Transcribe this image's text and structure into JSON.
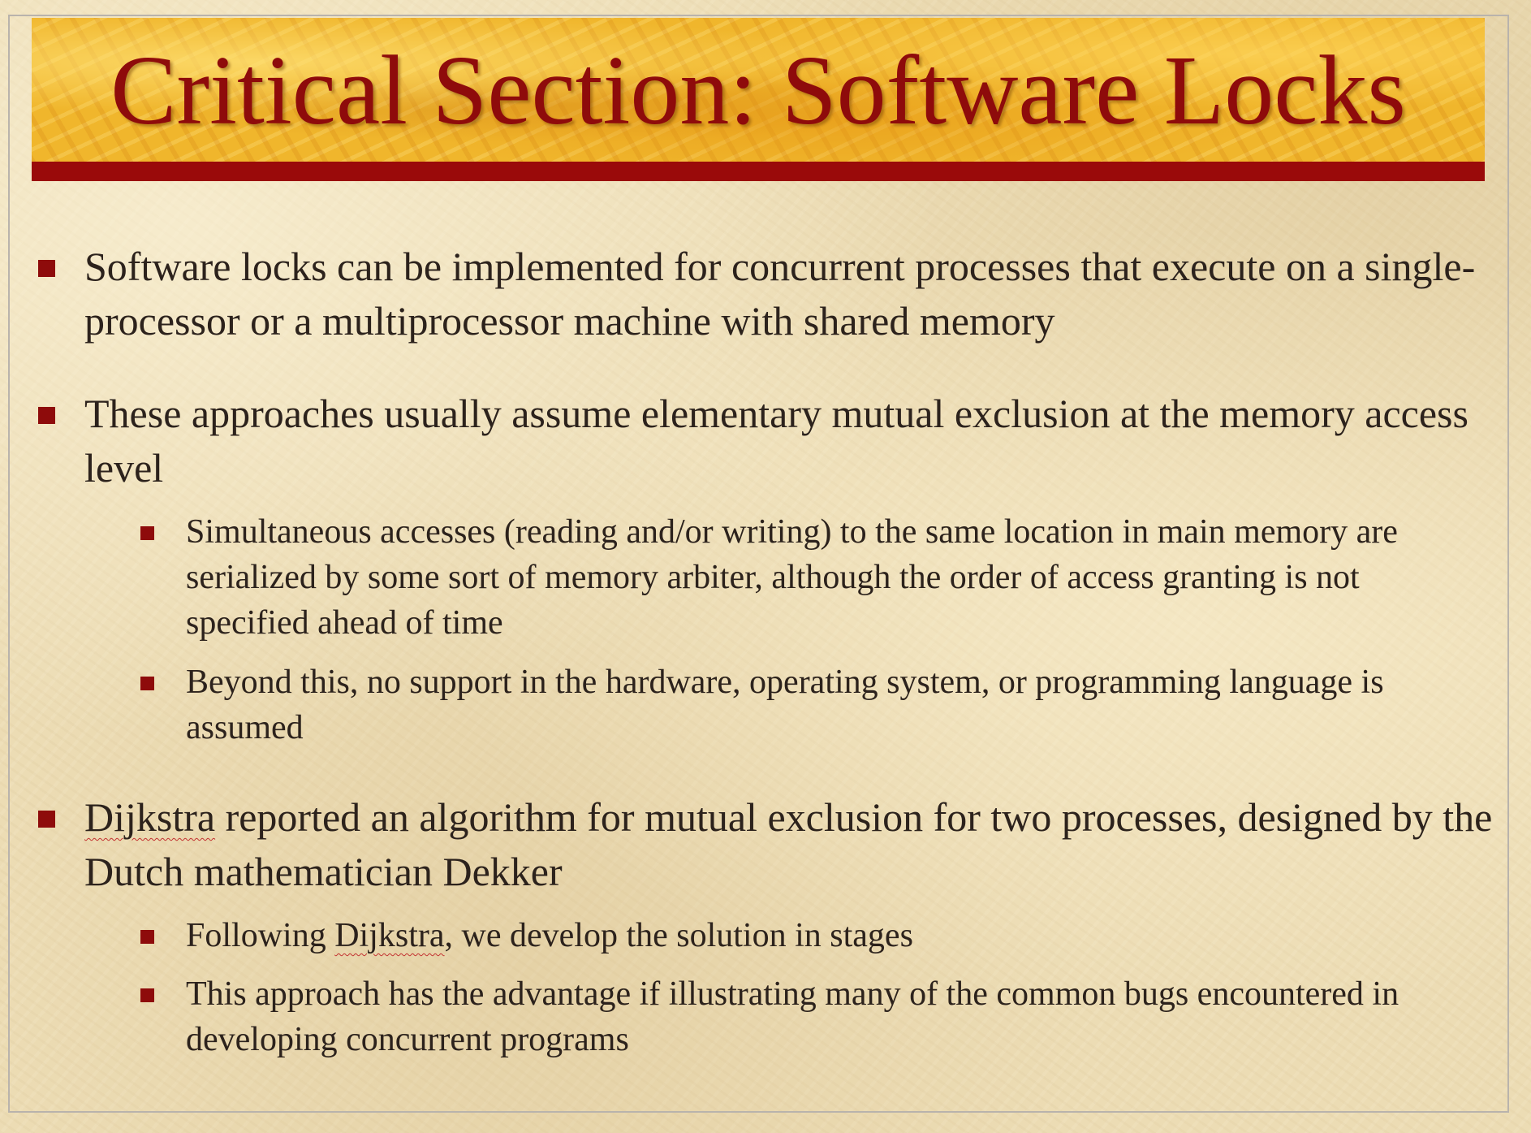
{
  "slide": {
    "title": "Critical Section: Software Locks",
    "accent_color": "#8e0b0b",
    "banner_color": "#f0b62c",
    "bullet_icon": "square-bullet-icon",
    "bullets": [
      {
        "text": "Software locks can be implemented for concurrent processes that execute on a single-processor or a multiprocessor machine with shared memory"
      },
      {
        "text": "These approaches usually assume elementary mutual exclusion at the memory access level",
        "sub": [
          {
            "text": "Simultaneous accesses (reading and/or writing) to the same location in main memory are serialized by some sort of memory arbiter, although the order of access granting is not specified ahead of time"
          },
          {
            "text": "Beyond this, no support in the hardware, operating system, or programming language is assumed"
          }
        ]
      },
      {
        "word": "Dijkstra",
        "rest": " reported an algorithm for mutual exclusion for two processes, designed by the Dutch mathematician Dekker",
        "sub": [
          {
            "prefix": "Following ",
            "word": "Dijkstra",
            "rest": ", we develop the solution in stages"
          },
          {
            "text": "This approach has the advantage if illustrating many of the common bugs encountered in developing concurrent programs"
          }
        ]
      }
    ]
  }
}
